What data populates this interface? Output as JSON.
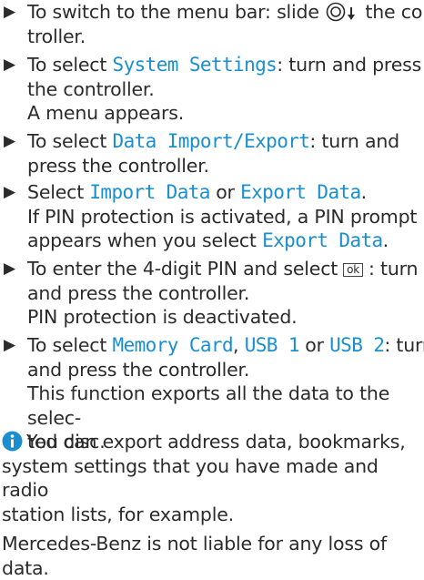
{
  "steps": [
    {
      "pre": "To switch to the menu bar: slide",
      "post": "the con-",
      "line2": "troller."
    },
    {
      "pre": "To select",
      "mono": "System Settings",
      "post": ": turn and press",
      "line2": "the controller.",
      "result": "A menu appears."
    },
    {
      "pre": "To select",
      "mono": "Data Import/Export",
      "post": ": turn and",
      "line2": "press the controller."
    },
    {
      "pre": "Select",
      "mono1": "Import Data",
      "mid": "or",
      "mono2": "Export Data",
      "post": ".",
      "result1": "If PIN protection is activated, a PIN prompt",
      "result2": "appears when you select",
      "result2_mono": "Export Data",
      "result2_post": "."
    },
    {
      "pre": "To enter the 4-digit PIN and select",
      "button": "ok",
      "post": ": turn",
      "line2": "and press the controller.",
      "result": "PIN protection is deactivated."
    },
    {
      "pre": "To select",
      "mono1": "Memory Card",
      "sep": ",",
      "mono2": "USB 1",
      "mid": "or",
      "mono3": "USB 2",
      "post": ": turn",
      "line2": "and press the controller.",
      "result1": "This function exports all the data to the selec-",
      "result2": "ted disc."
    }
  ],
  "note": {
    "line1": "You can export address data, bookmarks,",
    "line2": "system settings that you have made and radio",
    "line3": "station lists, for example.",
    "line4": "Mercedes-Benz is not liable for any loss of",
    "line5": "data."
  },
  "colors": {
    "text": "#2b2b2b",
    "highlight": "#1a8fd0",
    "info_icon": "#1a8fd0"
  },
  "icons": {
    "bullet": "triangle-arrow-icon",
    "controller": "controller-slide-down-icon",
    "info": "info-icon"
  }
}
